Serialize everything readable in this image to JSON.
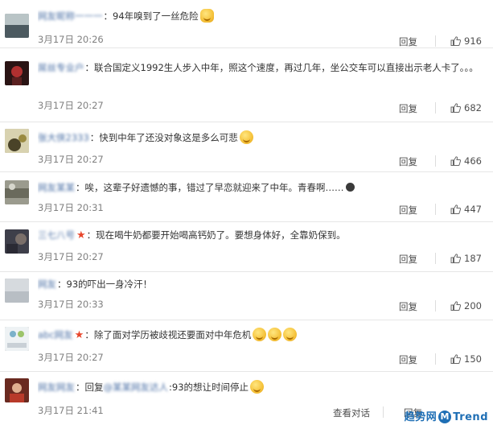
{
  "comments": [
    {
      "username": "网友昵称一一一",
      "text": "94年嗅到了一丝危险",
      "emojis": [
        "cat"
      ],
      "time": "3月17日 20:26",
      "reply_label": "回复",
      "likes": "916",
      "avatar_color": "#7d8a8f"
    },
    {
      "username": "屌丝专业户",
      "text": "联合国定义1992生人步入中年，照这个速度，再过几年，坐公交车可以直接出示老人卡了。。。",
      "emojis": [],
      "time": "3月17日 20:27",
      "reply_label": "回复",
      "likes": "682",
      "avatar_color": "#3a1c1c"
    },
    {
      "username": "张大侠2333",
      "text": "快到中年了还没对象这是多么可悲",
      "emojis": [
        "sad"
      ],
      "time": "3月17日 20:27",
      "reply_label": "回复",
      "likes": "466",
      "avatar_color": "#6b6234"
    },
    {
      "username": "网友某某",
      "text": "唉，这辈子好遗憾的事，错过了早恋就迎来了中年。青春啊……",
      "emojis": [
        "dark"
      ],
      "time": "3月17日 20:31",
      "reply_label": "回复",
      "likes": "447",
      "avatar_color": "#7a7a70"
    },
    {
      "username": "三七八号",
      "text": "现在喝牛奶都要开始喝高钙奶了。要想身体好，全靠奶保到。",
      "emojis": [],
      "star": true,
      "time": "3月17日 20:27",
      "reply_label": "回复",
      "likes": "187",
      "avatar_color": "#4a4a5a"
    },
    {
      "username": "网友",
      "text": "93的吓出一身冷汗！",
      "emojis": [],
      "time": "3月17日 20:33",
      "reply_label": "回复",
      "likes": "200",
      "avatar_color": "#cfd3d8"
    },
    {
      "username": "abc网友",
      "text": "除了面对学历被歧视还要面对中年危机",
      "emojis": [
        "sad",
        "sad",
        "sad"
      ],
      "star": true,
      "time": "3月17日 20:27",
      "reply_label": "回复",
      "likes": "150",
      "avatar_color": "#dfe6e9"
    },
    {
      "username": "网友网友",
      "text_prefix": "回复",
      "reply_to": "@某某网友达人",
      "text": "93的想让时间停止",
      "emojis": [
        "think"
      ],
      "time": "3月17日 21:41",
      "view_dialog_label": "查看对话",
      "reply_label": "回复",
      "avatar_color": "#8a3a2a"
    }
  ],
  "watermark": {
    "text_left": "趋势网",
    "text_right": "Trend"
  }
}
